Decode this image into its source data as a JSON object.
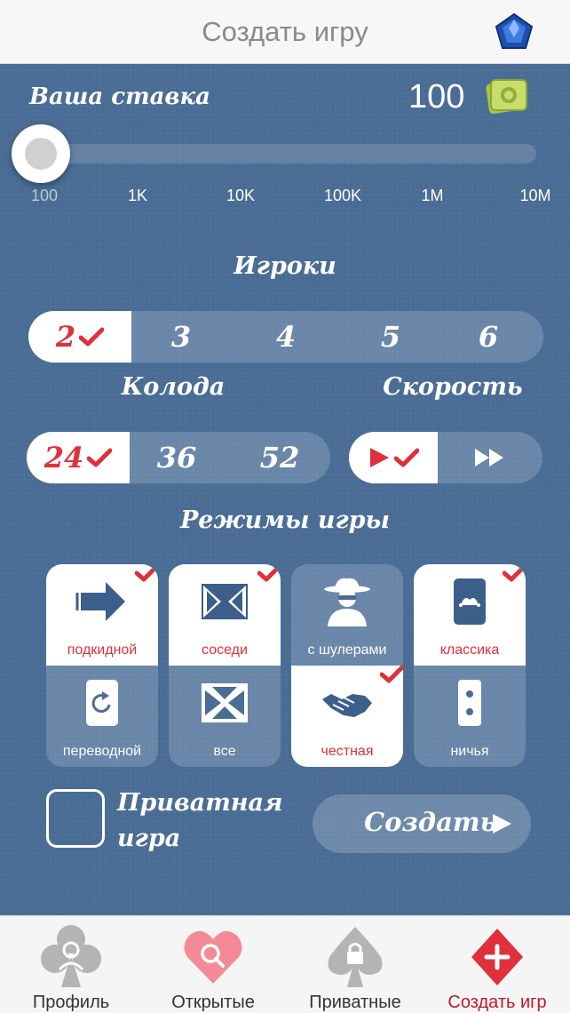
{
  "header": {
    "title": "Создать игру",
    "gem_icon": "gem-icon"
  },
  "bet": {
    "label": "Ваша ставка",
    "value": "100",
    "currency_icon": "banknote-icon",
    "slider_level": 0,
    "ticks": [
      "100",
      "1K",
      "10K",
      "100K",
      "1M",
      "10M"
    ]
  },
  "players": {
    "title": "Игроки",
    "options": [
      "2",
      "3",
      "4",
      "5",
      "6"
    ],
    "selected": "2"
  },
  "deck": {
    "title": "Колода",
    "options": [
      "24",
      "36",
      "52"
    ],
    "selected": "24"
  },
  "speed": {
    "title": "Скорость",
    "options": [
      "play-icon",
      "fast-forward-icon"
    ],
    "selected": "play-icon"
  },
  "modes": {
    "title": "Режимы игры",
    "columns": [
      {
        "top": {
          "label": "подкидной",
          "icon": "arrow-right-icon",
          "selected": true
        },
        "bottom": {
          "label": "переводной",
          "icon": "card-rotate-icon",
          "selected": false
        }
      },
      {
        "top": {
          "label": "соседи",
          "icon": "arrows-inward-icon",
          "selected": true
        },
        "bottom": {
          "label": "все",
          "icon": "arrows-four-icon",
          "selected": false
        }
      },
      {
        "top": {
          "label": "с шулерами",
          "icon": "cheater-icon",
          "selected": false
        },
        "bottom": {
          "label": "честная",
          "icon": "handshake-icon",
          "selected": true
        }
      },
      {
        "top": {
          "label": "классика",
          "icon": "card-jester-icon",
          "selected": true
        },
        "bottom": {
          "label": "ничья",
          "icon": "domino-icon",
          "selected": false
        }
      }
    ]
  },
  "private": {
    "label_line1": "Приватная",
    "label_line2": "игра",
    "checked": false
  },
  "create_button": {
    "label": "Создать"
  },
  "tabs": [
    {
      "label": "Профиль",
      "icon": "club-profile-icon",
      "active": false
    },
    {
      "label": "Открытые",
      "icon": "heart-search-icon",
      "active": false
    },
    {
      "label": "Приватные",
      "icon": "spade-lock-icon",
      "active": false
    },
    {
      "label": "Создать игр",
      "icon": "diamond-plus-icon",
      "active": true
    }
  ],
  "colors": {
    "accent": "#e0303a",
    "background": "#4a6d96",
    "tab_active": "#c0182a"
  }
}
